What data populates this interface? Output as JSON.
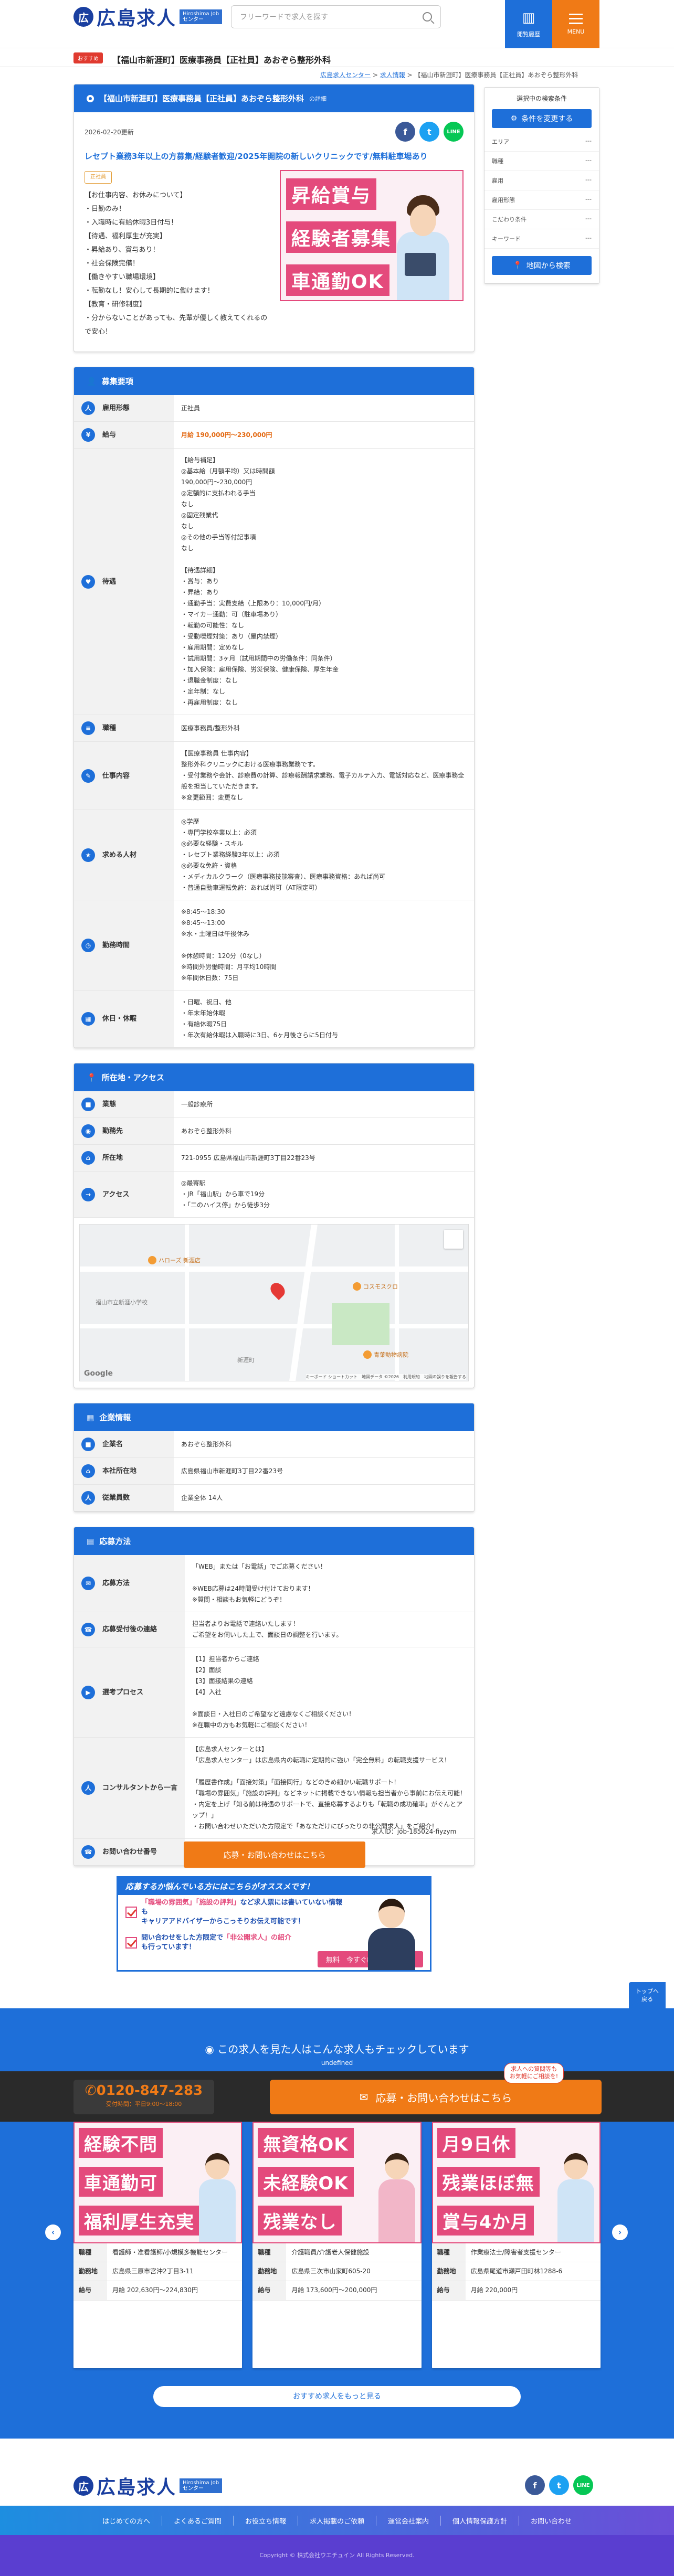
{
  "header": {
    "logo_mark": "広",
    "logo_text": "広島求人",
    "logo_sub_1": "Hiroshima Job",
    "logo_sub_2": "センター",
    "search_placeholder": "フリーワードで求人を探す",
    "btn_saved": "閲覧履歴",
    "btn_menu": "MENU"
  },
  "topbar": {
    "tag": "おすすめ",
    "title": "【福山市新涯町】医療事務員【正社員】あおぞら整形外科"
  },
  "breadcrumb": [
    "広島求人センター",
    "求人情報",
    "【福山市新涯町】医療事務員【正社員】あおぞら整形外科"
  ],
  "job": {
    "panel_title": "【福山市新涯町】医療事務員【正社員】あおぞら整形外科",
    "panel_title_sub": "の詳細",
    "date": "2026-02-20更新",
    "lead": "レセプト業務3年以上の方募集/経験者歓迎/2025年開院の新しいクリニックです/無料駐車場あり",
    "intro_badge": "正社員",
    "intro_text": "【お仕事内容、お休みについて】\n・日勤のみ！\n・入職時に有給休暇3日付与！\n【待遇、福利厚生が充実】\n・昇給あり、賞与あり！\n・社会保険完備！\n【働きやすい職場環境】\n・転勤なし！安心して長期的に働けます！\n【教育・研修制度】\n・分からないことがあっても、先輩が優しく教えてくれるので安心！",
    "hero_tags": [
      "昇給賞与",
      "経験者募集",
      "車通勤OK"
    ]
  },
  "recruit": {
    "title": "募集要項",
    "rows": [
      {
        "icon": "人",
        "label": "雇用形態",
        "value": "正社員"
      },
      {
        "icon": "¥",
        "label": "給与",
        "value": "月給 190,000円〜230,000円"
      },
      {
        "icon": "♥",
        "label": "待遇",
        "value": "【給与補足】\n◎基本給（月額平均）又は時間額\n190,000円〜230,000円\n◎定額的に支払われる手当\nなし\n◎固定残業代\nなし\n◎その他の手当等付記事項\nなし\n\n【待遇詳細】\n・賞与：あり\n・昇給：あり\n・通勤手当：実費支給（上限あり：10,000円/月）\n・マイカー通勤：可（駐車場あり）\n・転勤の可能性：なし\n・受動喫煙対策：あり（屋内禁煙）\n・雇用期間：定めなし\n・試用期間：3ヶ月（試用期間中の労働条件：同条件）\n・加入保険：雇用保険、労災保険、健康保険、厚生年金\n・退職金制度：なし\n・定年制：なし\n・再雇用制度：なし"
      },
      {
        "icon": "≡",
        "label": "職種",
        "value": "医療事務員/整形外科"
      },
      {
        "icon": "✎",
        "label": "仕事内容",
        "value": "【医療事務員 仕事内容】\n整形外科クリニックにおける医療事務業務です。\n・受付業務や会計、診療費の計算、診療報酬請求業務、電子カルテ入力、電話対応など、医療事務全般を担当していただきます。\n※変更範囲：変更なし"
      },
      {
        "icon": "★",
        "label": "求める人材",
        "value": "◎学歴\n・専門学校卒業以上：必須\n◎必要な経験・スキル\n・レセプト業務経験3年以上：必須\n◎必要な免許・資格\n・メディカルクラーク（医療事務技能審査）、医療事務資格：あれば尚可\n・普通自動車運転免許：あれば尚可（AT限定可）"
      },
      {
        "icon": "◷",
        "label": "勤務時間",
        "value": "※8:45〜18:30\n※8:45〜13:00\n※水・土曜日は午後休み\n\n※休憩時間：120分（0なし）\n※時間外労働時間：月平均10時間\n※年間休日数：75日"
      },
      {
        "icon": "▦",
        "label": "休日・休暇",
        "value": "・日曜、祝日、他\n・年末年始休暇\n・有給休暇75日\n・年次有給休暇は入職時に3日、6ヶ月後さらに5日付与"
      }
    ]
  },
  "access": {
    "title": "所在地・アクセス",
    "rows": [
      {
        "icon": "■",
        "label": "業態",
        "value": "一般診療所"
      },
      {
        "icon": "◉",
        "label": "勤務先",
        "value": "あおぞら整形外科"
      },
      {
        "icon": "⌂",
        "label": "所在地",
        "value": "721-0955 広島県福山市新涯町3丁目22番23号"
      },
      {
        "icon": "→",
        "label": "アクセス",
        "value": "◎最寄駅\n・JR「福山駅」から車で19分\n・「二のハイス停」から徒歩3分"
      }
    ],
    "map_labels": {
      "poi1": "ハローズ 新涯店",
      "poi2": "福山市立新涯小学校",
      "poi3": "コスモスクロ",
      "poi4": "青葉動物病院",
      "road": "新涯町",
      "attribution": "キーボード ショートカット　地図データ ©2026　利用規約　地図の誤りを報告する",
      "google": "Google"
    }
  },
  "company": {
    "title": "企業情報",
    "rows": [
      {
        "icon": "■",
        "label": "企業名",
        "value": "あおぞら整形外科"
      },
      {
        "icon": "⌂",
        "label": "本社所在地",
        "value": "広島県福山市新涯町3丁目22番23号"
      },
      {
        "icon": "人",
        "label": "従業員数",
        "value": "企業全体 14人"
      }
    ]
  },
  "apply": {
    "title": "応募方法",
    "rows": [
      {
        "icon": "✉",
        "label": "応募方法",
        "value": "「WEB」または「お電話」でご応募ください！\n\n※WEB応募は24時間受け付けております！\n※質問・相談もお気軽にどうぞ！"
      },
      {
        "icon": "☎",
        "label": "応募受付後の連絡",
        "value": "担当者よりお電話で連絡いたします！\nご希望をお伺いした上で、面談日の調整を行います。"
      },
      {
        "icon": "▶",
        "label": "選考プロセス",
        "value": "【1】担当者からご連絡\n【2】面談\n【3】面接結果の連絡\n【4】入社\n\n※面談日・入社日のご希望など遠慮なくご相談ください！\n※在職中の方もお気軽にご相談ください！"
      },
      {
        "icon": "人",
        "label": "コンサルタントから一言",
        "value": "【広島求人センターとは】\n「広島求人センター」は広島県内の転職に定期的に強い「完全無料」の転職支援サービス！\n\n「履歴書作成」「面接対策」「面接同行」などのきめ細かい転職サポート！\n「職場の雰囲気」「施設の評判」などネットに掲載できない情報も担当者から事前にお伝え可能！\n・内定を上げ「知る前は待遇のサポートで、直接応募するよりも「転職の成功確率」がぐんとアップ！」\n・お問い合わせいただいた方限定で「あなただけにぴったりの非公開求人」をご紹介！"
      },
      {
        "icon": "☎",
        "label": "お問い合わせ番号",
        "value": "0120-847-283"
      }
    ]
  },
  "job_id": "求人ID：job-185024-fiyzym",
  "cta_label": "応募・お問い合わせはこちら",
  "banner": {
    "title": "応募するか悩んでいる方にはこちらがオススメです！",
    "row1_a": "「職場の雰囲気」「施設の評判」",
    "row1_b": "など求人票には書いていない情報も",
    "row1_c": "キャリアアドバイザーからこっそりお伝え可能です！",
    "row2_a": "問い合わせをした方限定で",
    "row2_b": "「非公開求人」の紹介",
    "row2_c": "も行っています！",
    "free_btn": "無料　今すぐ教えてもらう ▶"
  },
  "to_top": "トップへ\n戻る",
  "sidebar": {
    "title": "選択中の検索条件",
    "change_btn": "条件を変更する",
    "conditions": [
      {
        "label": "エリア",
        "value": "---"
      },
      {
        "label": "職種",
        "value": "---"
      },
      {
        "label": "雇用",
        "value": "---"
      },
      {
        "label": "雇用形態",
        "value": "---"
      },
      {
        "label": "こだわり条件",
        "value": "---"
      },
      {
        "label": "キーワード",
        "value": "---"
      }
    ],
    "map_btn": "地図から検索"
  },
  "similar": {
    "heading": "この求人を見た人はこんな求人もチェックしています",
    "sub": "undefined",
    "tel_number": "0120-847-283",
    "tel_hours": "受付時間：平日9:00〜18:00",
    "apply_label": "応募・お問い合わせはこちら",
    "apply_badge": "求人への質問等も\nお気軽にご相談を!",
    "cards": [
      {
        "tags": [
          "経験不問",
          "車通勤可",
          "福利厚生充実"
        ],
        "rows": [
          {
            "k": "職種",
            "v": "看護師・准看護師/小規模多機能センター"
          },
          {
            "k": "勤務地",
            "v": "広島県三原市宮沖2丁目3-11"
          },
          {
            "k": "給与",
            "v": "月給 202,630円〜224,830円"
          }
        ]
      },
      {
        "tags": [
          "無資格OK",
          "未経験OK",
          "残業なし"
        ],
        "rows": [
          {
            "k": "職種",
            "v": "介護職員/介護老人保健施設"
          },
          {
            "k": "勤務地",
            "v": "広島県三次市山家町605-20"
          },
          {
            "k": "給与",
            "v": "月給 173,600円〜200,000円"
          }
        ]
      },
      {
        "tags": [
          "月9日休",
          "残業ほぼ無",
          "賞与4か月"
        ],
        "rows": [
          {
            "k": "職種",
            "v": "作業療法士/障害者支援センター"
          },
          {
            "k": "勤務地",
            "v": "広島県尾道市瀬戸田町林1288-6"
          },
          {
            "k": "給与",
            "v": "月給 220,000円"
          }
        ]
      }
    ],
    "more_btn": "おすすめ求人をもっと見る"
  },
  "footer": {
    "nav": [
      "はじめての方へ",
      "よくあるご質問",
      "お役立ち情報",
      "求人掲載のご依頼",
      "運営会社案内",
      "個人情報保護方針",
      "お問い合わせ"
    ],
    "copyright": "Copyright © 株式会社ウエチュイン All Rights Reserved."
  }
}
